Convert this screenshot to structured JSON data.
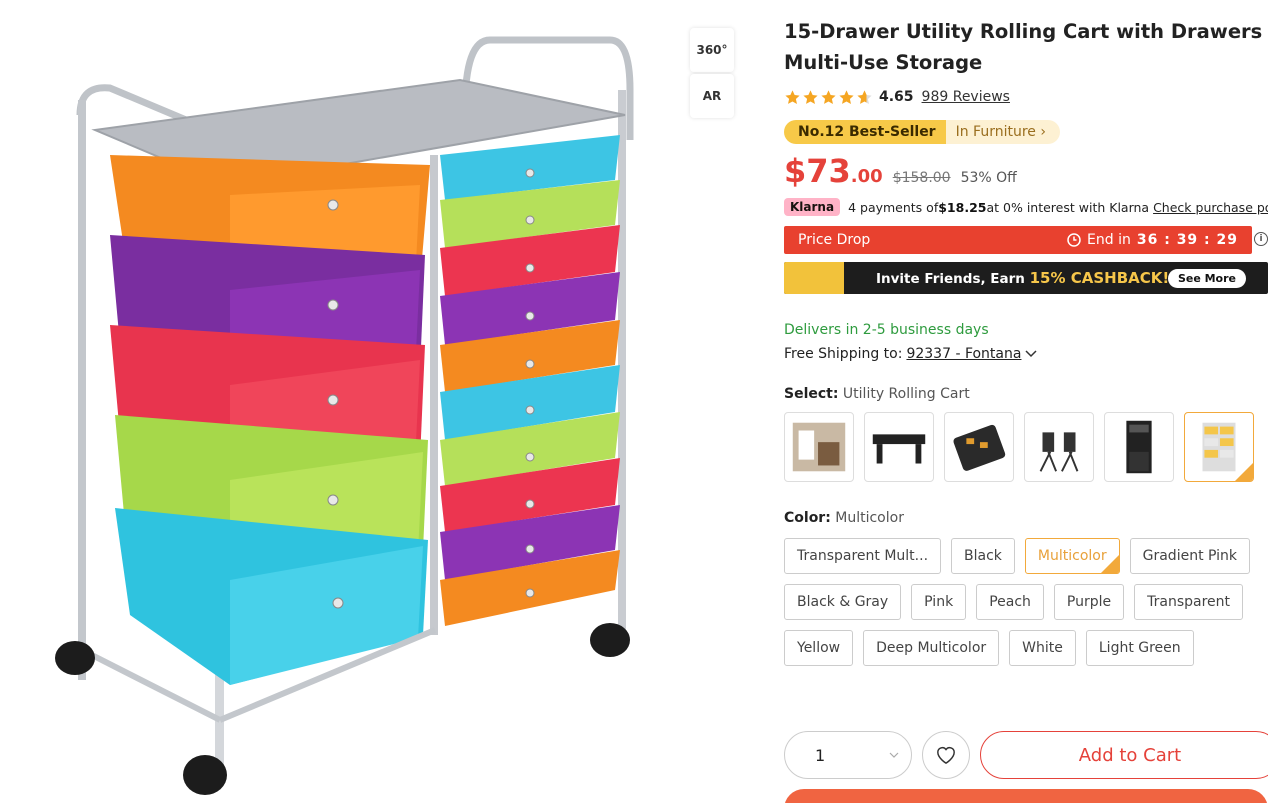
{
  "view_buttons": {
    "view360": "360°",
    "ar": "AR"
  },
  "product": {
    "title": "15-Drawer Utility Rolling Cart with Drawers Multi-Use Storage",
    "rating": "4.65",
    "stars_value": 4.65,
    "reviews": "989 Reviews",
    "bestseller_rank": "No.12 Best-Seller",
    "bestseller_category": "In Furniture ›",
    "price_dollars": "$73",
    "price_cents": ".00",
    "price_original": "$158.00",
    "price_off": "53% Off"
  },
  "klarna": {
    "badge": "Klarna",
    "text_pre": "4 payments of ",
    "amount": "$18.25",
    "text_post": " at 0% interest with Klarna",
    "link": "Check purchase power"
  },
  "price_drop": {
    "label": "Price Drop",
    "end_label": "End in",
    "timer": "36 : 39 : 29",
    "info": "i"
  },
  "invite": {
    "text": "Invite Friends, Earn ",
    "cashback": "15% CASHBACK!",
    "see_more": "See More"
  },
  "delivery": {
    "delivers": "Delivers in 2-5 business days",
    "shipping_label": "Free Shipping to:",
    "zip": "92337 - Fontana"
  },
  "select": {
    "label": "Select:",
    "value": "Utility Rolling Cart",
    "thumbnails": [
      "room-scene",
      "black-table",
      "tool-organizer",
      "folding-chairs",
      "black-cabinet",
      "rolling-cart"
    ],
    "selected_index": 5
  },
  "color": {
    "label": "Color:",
    "value": "Multicolor",
    "options": [
      "Transparent Mult...",
      "Black",
      "Multicolor",
      "Gradient Pink",
      "Black & Gray",
      "Pink",
      "Peach",
      "Purple",
      "Transparent",
      "Yellow",
      "Deep Multicolor",
      "White",
      "Light Green"
    ],
    "selected_index": 2
  },
  "purchase": {
    "quantity": "1",
    "add_to_cart": "Add to Cart"
  },
  "colors": {
    "accent": "#e5423a",
    "gold": "#f2a93b",
    "green": "#2e9b3e",
    "klarna": "#ffb3c7"
  }
}
